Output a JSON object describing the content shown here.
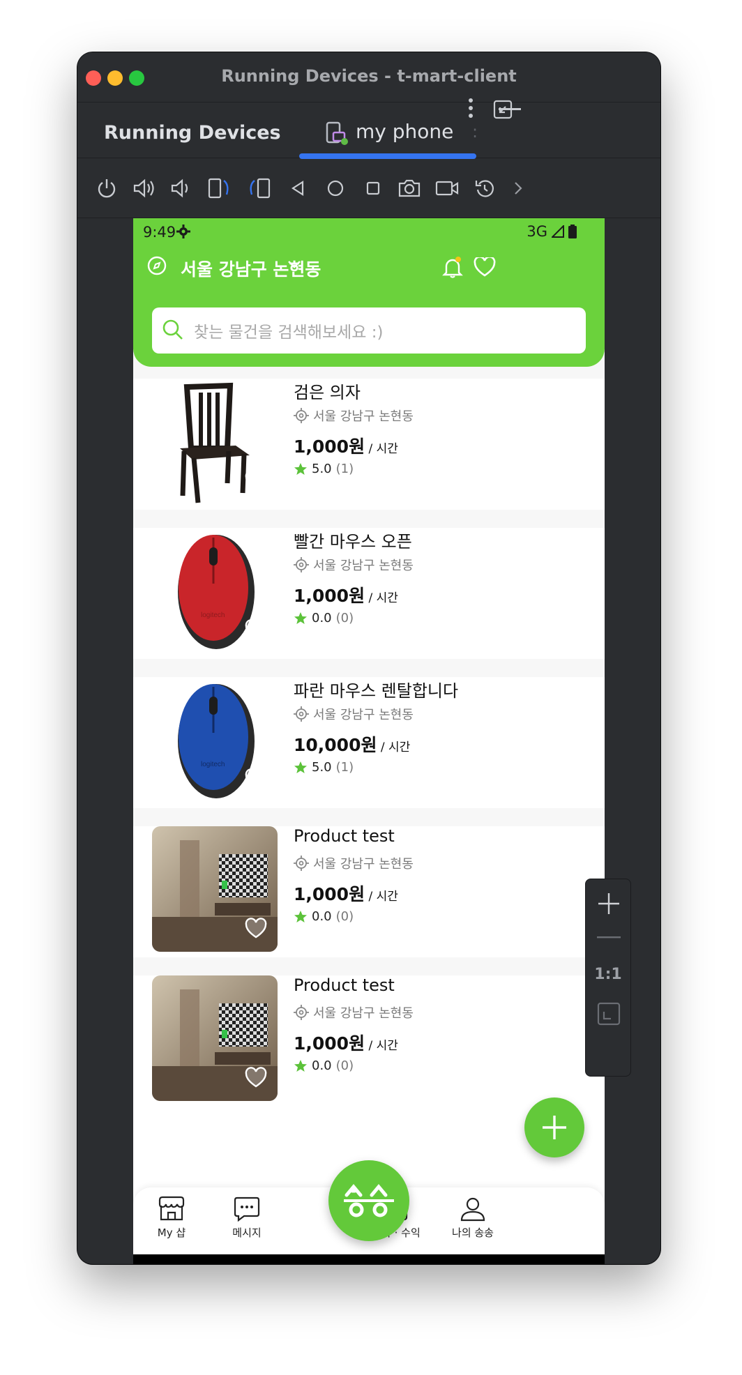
{
  "window": {
    "title": "Running Devices - t-mart-client",
    "panel_title": "Running Devices",
    "tab_label": "my phone"
  },
  "toolbar": {
    "buttons": [
      "power-icon",
      "volume-up-icon",
      "volume-down-icon",
      "rotate-left-icon",
      "rotate-right-icon",
      "back-icon",
      "home-icon",
      "overview-icon",
      "screenshot-icon",
      "screen-record-icon",
      "reset-icon",
      "more-chevron-icon"
    ]
  },
  "zoom": {
    "one_to_one": "1:1"
  },
  "phone": {
    "status": {
      "time": "9:49",
      "network": "3G"
    },
    "header": {
      "location": "서울 강남구 논현동"
    },
    "search": {
      "placeholder": "찾는 물건을 검색해보세요 :)"
    },
    "products": [
      {
        "title": "검은 의자",
        "location": "서울 강남구 논현동",
        "price": "1,000원",
        "unit": " / 시간",
        "rating": "5.0",
        "count": "(1)",
        "image": "black-chair"
      },
      {
        "title": "빨간 마우스 오픈",
        "location": "서울 강남구 논현동",
        "price": "1,000원",
        "unit": " / 시간",
        "rating": "0.0",
        "count": "(0)",
        "image": "red-mouse"
      },
      {
        "title": "파란 마우스 렌탈합니다",
        "location": "서울 강남구 논현동",
        "price": "10,000원",
        "unit": " / 시간",
        "rating": "5.0",
        "count": "(1)",
        "image": "blue-mouse"
      },
      {
        "title": "Product test",
        "location": "서울 강남구 논현동",
        "price": "1,000원",
        "unit": " / 시간",
        "rating": "0.0",
        "count": "(0)",
        "image": "room-tv"
      },
      {
        "title": "Product test",
        "location": "서울 강남구 논현동",
        "price": "1,000원",
        "unit": " / 시간",
        "rating": "0.0",
        "count": "(0)",
        "image": "room-tv"
      }
    ],
    "bottom_nav": {
      "my_shop": "My 샵",
      "message": "메시지",
      "reservation": "예약 · 수익",
      "my_songsong": "나의 송송"
    },
    "colors": {
      "brand": "#6bd23c",
      "accent": "#63c93a",
      "dot": "#f5c518"
    }
  }
}
